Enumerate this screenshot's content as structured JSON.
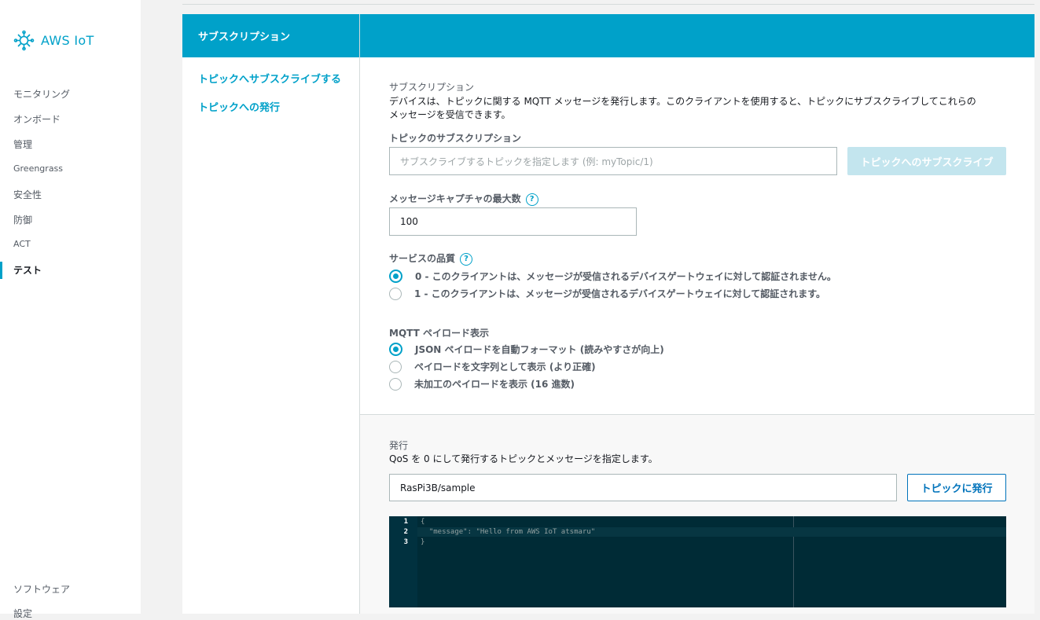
{
  "app": {
    "logo_text": "AWS IoT"
  },
  "nav": {
    "items": [
      {
        "label": "モニタリング"
      },
      {
        "label": "オンボード"
      },
      {
        "label": "管理"
      },
      {
        "label": "Greengrass"
      },
      {
        "label": "安全性"
      },
      {
        "label": "防御"
      },
      {
        "label": "ACT"
      },
      {
        "label": "テスト"
      }
    ],
    "bottom_items": [
      {
        "label": "ソフトウェア"
      },
      {
        "label": "設定"
      }
    ]
  },
  "subnav": {
    "header": "サブスクリプション",
    "links": [
      {
        "label": "トピックへサブスクライブする"
      },
      {
        "label": "トピックへの発行"
      }
    ]
  },
  "subscribe": {
    "title": "サブスクリプション",
    "description_line1": "デバイスは、トピックに関する MQTT メッセージを発行します。このクライアントを使用すると、トピックにサブスクライブしてこれらの",
    "description_line2": "メッセージを受信できます。",
    "topic_label": "トピックのサブスクリプション",
    "topic_placeholder": "サブスクライブするトピックを指定します (例: myTopic/1)",
    "subscribe_button": "トピックへのサブスクライブ",
    "max_capture_label": "メッセージキャプチャの最大数",
    "max_capture_value": "100",
    "qos_label": "サービスの品質",
    "qos_options": [
      {
        "label": "0 - このクライアントは、メッセージが受信されるデバイスゲートウェイに対して認証されません。",
        "checked": true
      },
      {
        "label": "1 - このクライアントは、メッセージが受信されるデバイスゲートウェイに対して認証されます。",
        "checked": false
      }
    ],
    "payload_label": "MQTT ペイロード表示",
    "payload_options": [
      {
        "label": "JSON ペイロードを自動フォーマット (読みやすさが向上)",
        "checked": true
      },
      {
        "label": "ペイロードを文字列として表示 (より正確)",
        "checked": false
      },
      {
        "label": "未加工のペイロードを表示 (16 進数)",
        "checked": false
      }
    ],
    "help_glyph": "?"
  },
  "publish": {
    "title": "発行",
    "description": "QoS を 0 にして発行するトピックとメッセージを指定します。",
    "topic_value": "RasPi3B/sample",
    "publish_button": "トピックに発行",
    "code_lines": [
      {
        "num": "1",
        "text": "{"
      },
      {
        "num": "2",
        "text": "  \"message\": \"Hello from AWS IoT atsmaru\""
      },
      {
        "num": "3",
        "text": "}"
      }
    ]
  },
  "colors": {
    "accent": "#00a1c9",
    "link": "#0073bb",
    "editor_bg": "#002b36"
  }
}
